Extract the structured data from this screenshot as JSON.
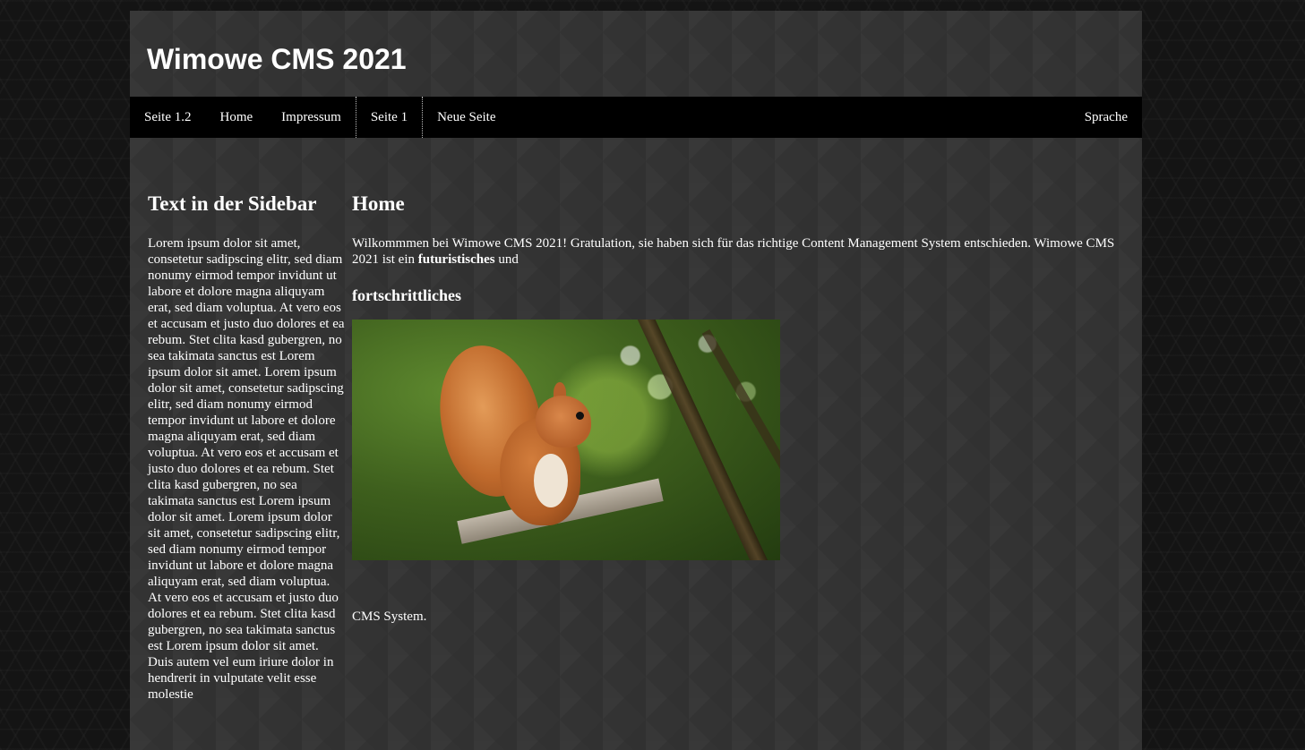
{
  "header": {
    "site_title": "Wimowe CMS 2021"
  },
  "nav": {
    "items": [
      {
        "label": "Seite 1.2"
      },
      {
        "label": "Home"
      },
      {
        "label": "Impressum"
      },
      {
        "label": "Seite 1"
      },
      {
        "label": "Neue Seite"
      }
    ],
    "active_index": 3,
    "right_label": "Sprache"
  },
  "sidebar": {
    "heading": "Text in der Sidebar",
    "text": "Lorem ipsum dolor sit amet, consetetur sadipscing elitr, sed diam nonumy eirmod tempor invidunt ut labore et dolore magna aliquyam erat, sed diam voluptua. At vero eos et accusam et justo duo dolores et ea rebum. Stet clita kasd gubergren, no sea takimata sanctus est Lorem ipsum dolor sit amet. Lorem ipsum dolor sit amet, consetetur sadipscing elitr, sed diam nonumy eirmod tempor invidunt ut labore et dolore magna aliquyam erat, sed diam voluptua. At vero eos et accusam et justo duo dolores et ea rebum. Stet clita kasd gubergren, no sea takimata sanctus est Lorem ipsum dolor sit amet. Lorem ipsum dolor sit amet, consetetur sadipscing elitr, sed diam nonumy eirmod tempor invidunt ut labore et dolore magna aliquyam erat, sed diam voluptua. At vero eos et accusam et justo duo dolores et ea rebum. Stet clita kasd gubergren, no sea takimata sanctus est Lorem ipsum dolor sit amet. Duis autem vel eum iriure dolor in hendrerit in vulputate velit esse molestie"
  },
  "main": {
    "heading": "Home",
    "intro_text": "Wilkommmen bei Wimowe CMS 2021! Gratulation, sie haben sich für das richtige Content Management System entschieden. Wimowe CMS 2021 ist ein ",
    "intro_bold": "futuristisches",
    "intro_tail": " und",
    "subheading": "fortschrittliches",
    "image_icon": "squirrel-photo",
    "caption": "CMS System."
  }
}
